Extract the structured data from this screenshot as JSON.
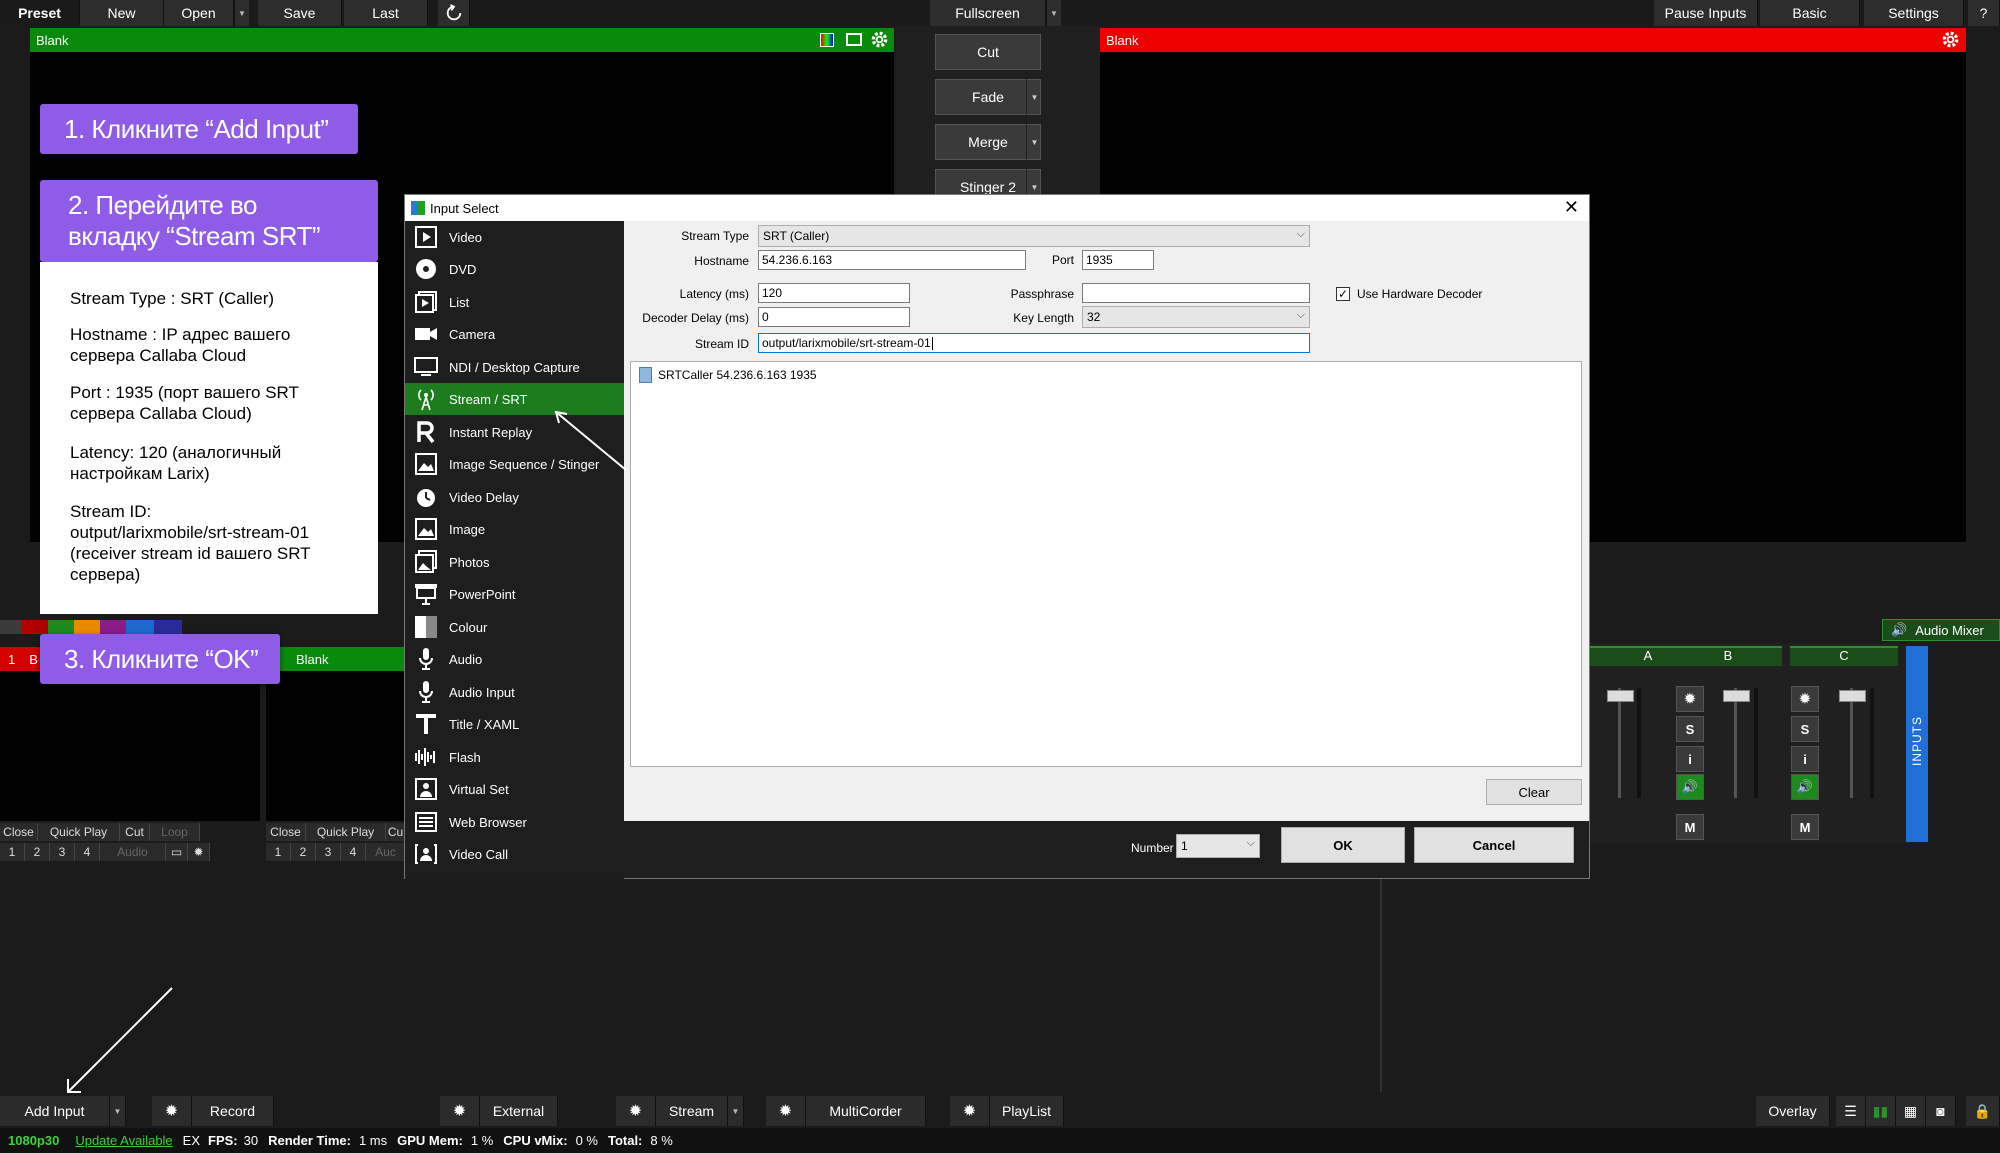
{
  "toolbar": {
    "preset": "Preset",
    "new": "New",
    "open": "Open",
    "save": "Save",
    "last": "Last",
    "fullscreen": "Fullscreen",
    "pause_inputs": "Pause Inputs",
    "basic": "Basic",
    "settings": "Settings",
    "help": "?"
  },
  "preview": {
    "title": "Blank"
  },
  "output": {
    "title": "Blank"
  },
  "transitions": {
    "cut": "Cut",
    "fade": "Fade",
    "merge": "Merge",
    "stinger": "Stinger 2"
  },
  "callouts": {
    "step1": "1. Кликните “Add Input”",
    "step2_line1": "2. Перейдите во",
    "step2_line2": "вкладку “Stream SRT”",
    "step3": "3. Кликните “OK”"
  },
  "info": {
    "stream_type": "Stream Type : SRT (Caller)",
    "hostname_l1": "Hostname : IP адрес вашего",
    "hostname_l2": "сервера Callaba Cloud",
    "port_l1": "Port : 1935 (порт вашего SRT",
    "port_l2": "сервера Callaba Cloud)",
    "latency_l1": "Latency: 120 (аналогичный",
    "latency_l2": "настройкам Larix)",
    "streamid_l1": "Stream ID:",
    "streamid_l2": "output/larixmobile/srt-stream-01",
    "streamid_l3": "(receiver stream id вашего SRT",
    "streamid_l4": "сервера)"
  },
  "dialog": {
    "title": "Input Select",
    "categories": [
      "Video",
      "DVD",
      "List",
      "Camera",
      "NDI / Desktop Capture",
      "Stream / SRT",
      "Instant Replay",
      "Image Sequence / Stinger",
      "Video Delay",
      "Image",
      "Photos",
      "PowerPoint",
      "Colour",
      "Audio",
      "Audio Input",
      "Title / XAML",
      "Flash",
      "Virtual Set",
      "Web Browser",
      "Video Call"
    ],
    "labels": {
      "stream_type": "Stream Type",
      "hostname": "Hostname",
      "port": "Port",
      "latency": "Latency (ms)",
      "passphrase": "Passphrase",
      "decoder_delay": "Decoder Delay (ms)",
      "key_length": "Key Length",
      "stream_id": "Stream ID",
      "use_hw_decoder": "Use Hardware Decoder",
      "number": "Number"
    },
    "values": {
      "stream_type": "SRT (Caller)",
      "hostname": "54.236.6.163",
      "port": "1935",
      "latency": "120",
      "passphrase": "",
      "decoder_delay": "0",
      "key_length": "32",
      "stream_id": "output/larixmobile/srt-stream-01",
      "number": "1"
    },
    "list_item": "SRTCaller 54.236.6.163 1935",
    "clear": "Clear",
    "ok": "OK",
    "cancel": "Cancel"
  },
  "inputs_row": {
    "input1_num": "1",
    "input1_letter": "B",
    "input2_title": "Blank",
    "tabs": [
      "Close",
      "Quick Play",
      "Cut",
      "Loop"
    ],
    "tabs2": [
      "Close",
      "Quick Play",
      "Cu"
    ],
    "nums": [
      "1",
      "2",
      "3",
      "4"
    ],
    "audio": "Audio",
    "audio2": "Auc"
  },
  "mixer": {
    "title": "Audio Mixer",
    "channels": [
      "A",
      "B",
      "C"
    ],
    "s": "S",
    "i": "i",
    "m": "M",
    "inputs_label": "INPUTS"
  },
  "bottom": {
    "add_input": "Add Input",
    "record": "Record",
    "external": "External",
    "stream": "Stream",
    "multicorder": "MultiCorder",
    "playlist": "PlayList",
    "overlay": "Overlay"
  },
  "status": {
    "resolution": "1080p30",
    "update": "Update Available",
    "ex": "EX",
    "fps_label": "FPS:",
    "fps": "30",
    "render_label": "Render Time:",
    "render": "1 ms",
    "gpu_label": "GPU Mem:",
    "gpu": "1 %",
    "cpu_label": "CPU vMix:",
    "cpu": "0 %",
    "total_label": "Total:",
    "total": "8 %"
  }
}
